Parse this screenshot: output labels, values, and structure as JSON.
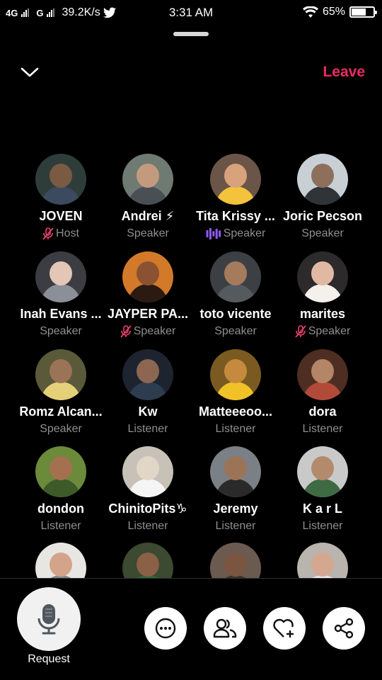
{
  "status_bar": {
    "network1": "4G",
    "network2": "G",
    "speed": "39.2K/s",
    "time": "3:31 AM",
    "battery": "65%",
    "battery_level": 0.65
  },
  "header": {
    "leave_label": "Leave",
    "leave_color": "#ea2a64"
  },
  "participants": [
    {
      "name": "JOVEN",
      "role": "Host",
      "icon": "muted-mic-icon"
    },
    {
      "name": "Andrei ⚡",
      "role": "Speaker",
      "icon": ""
    },
    {
      "name": "Tita Krissy ...",
      "role": "Speaker",
      "icon": "speaking-wave-icon"
    },
    {
      "name": "Joric Pecson",
      "role": "Speaker",
      "icon": ""
    },
    {
      "name": "Inah Evans ...",
      "role": "Speaker",
      "icon": ""
    },
    {
      "name": "JAYPER PA...",
      "role": "Speaker",
      "icon": "muted-mic-icon"
    },
    {
      "name": "toto vicente",
      "role": "Speaker",
      "icon": ""
    },
    {
      "name": "marites",
      "role": "Speaker",
      "icon": "muted-mic-icon"
    },
    {
      "name": "Romz Alcan...",
      "role": "Speaker",
      "icon": ""
    },
    {
      "name": "Kw",
      "role": "Listener",
      "icon": ""
    },
    {
      "name": "Matteeeoo...",
      "role": "Listener",
      "icon": ""
    },
    {
      "name": "dora",
      "role": "Listener",
      "icon": ""
    },
    {
      "name": "dondon",
      "role": "Listener",
      "icon": ""
    },
    {
      "name": "ChinitoPits♑",
      "role": "Listener",
      "icon": ""
    },
    {
      "name": "Jeremy",
      "role": "Listener",
      "icon": ""
    },
    {
      "name": "K a r L",
      "role": "Listener",
      "icon": ""
    },
    {
      "name": "",
      "role": "",
      "icon": ""
    },
    {
      "name": "",
      "role": "",
      "icon": ""
    },
    {
      "name": "",
      "role": "",
      "icon": ""
    },
    {
      "name": "",
      "role": "",
      "icon": ""
    }
  ],
  "bottom_bar": {
    "request_label": "Request",
    "buttons": [
      "more-icon",
      "people-icon",
      "heart-plus-icon",
      "share-icon"
    ]
  },
  "colors": {
    "muted": "#e8416c",
    "speaking": "#8f5cf6",
    "secondary_text": "#8f8f8f"
  }
}
